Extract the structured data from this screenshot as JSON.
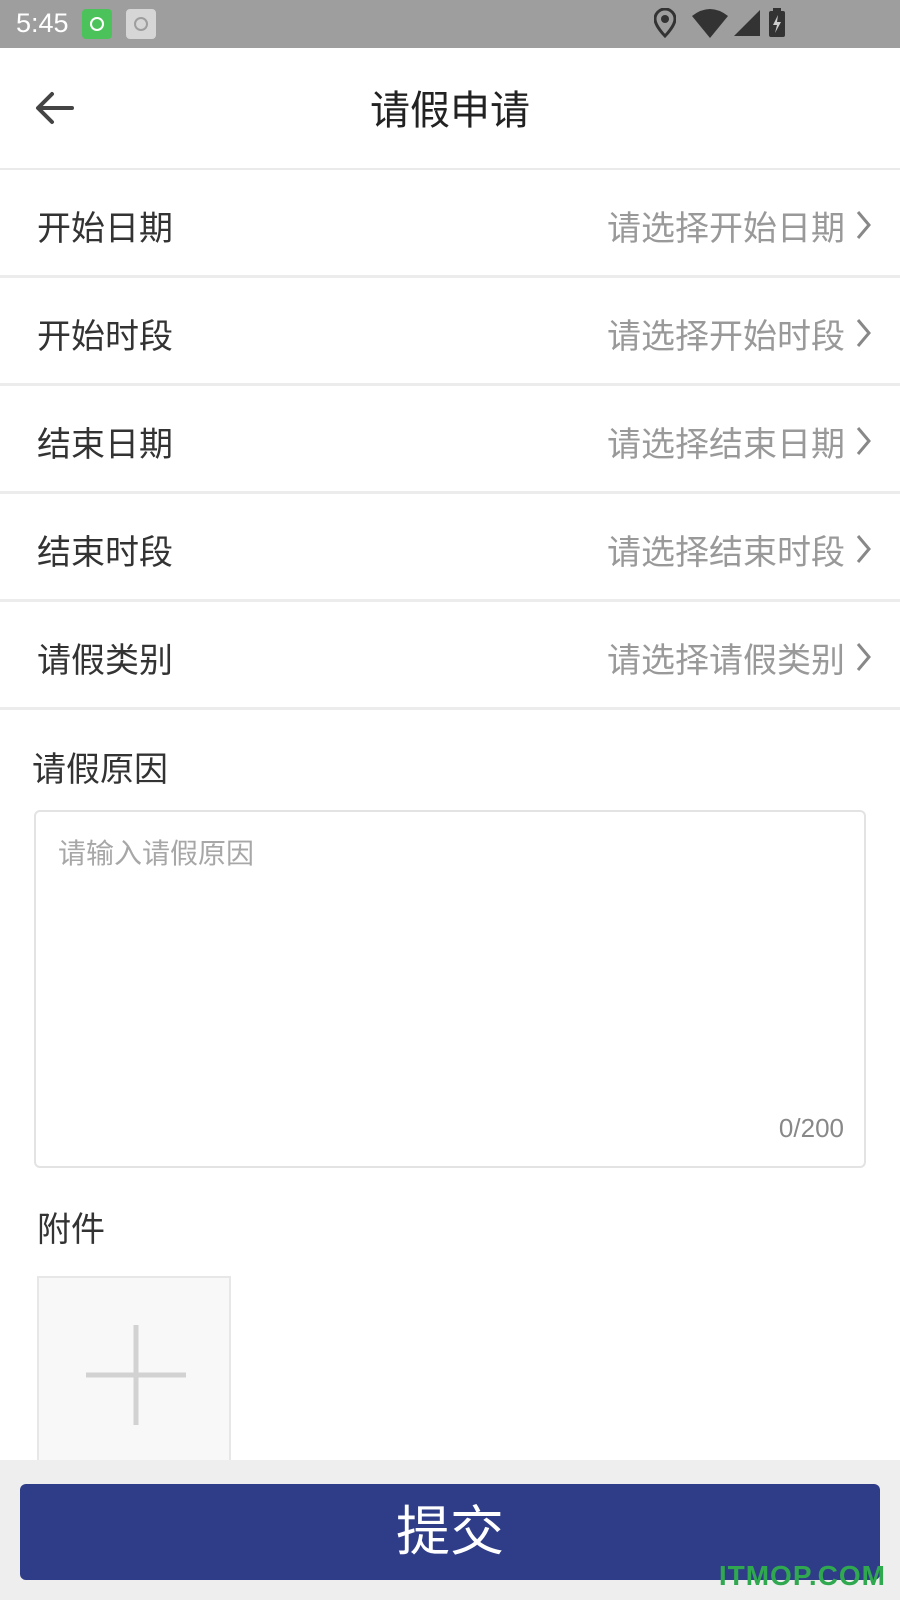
{
  "status_bar": {
    "time": "5:45"
  },
  "header": {
    "title": "请假申请"
  },
  "form": {
    "rows": [
      {
        "label": "开始日期",
        "placeholder": "请选择开始日期"
      },
      {
        "label": "开始时段",
        "placeholder": "请选择开始时段"
      },
      {
        "label": "结束日期",
        "placeholder": "请选择结束日期"
      },
      {
        "label": "结束时段",
        "placeholder": "请选择结束时段"
      },
      {
        "label": "请假类别",
        "placeholder": "请选择请假类别"
      }
    ],
    "reason": {
      "label": "请假原因",
      "placeholder": "请输入请假原因",
      "value": "",
      "counter": "0/200"
    },
    "attachment": {
      "label": "附件"
    }
  },
  "footer": {
    "submit_label": "提交"
  },
  "watermark": "ITMOP.COM",
  "colors": {
    "primary": "#2f3d88",
    "status_bar": "#9e9e9e",
    "hint": "#999999"
  },
  "icons": [
    "back-arrow-icon",
    "chevron-right-icon",
    "plus-icon",
    "location-icon",
    "wifi-icon",
    "signal-icon",
    "battery-icon"
  ]
}
